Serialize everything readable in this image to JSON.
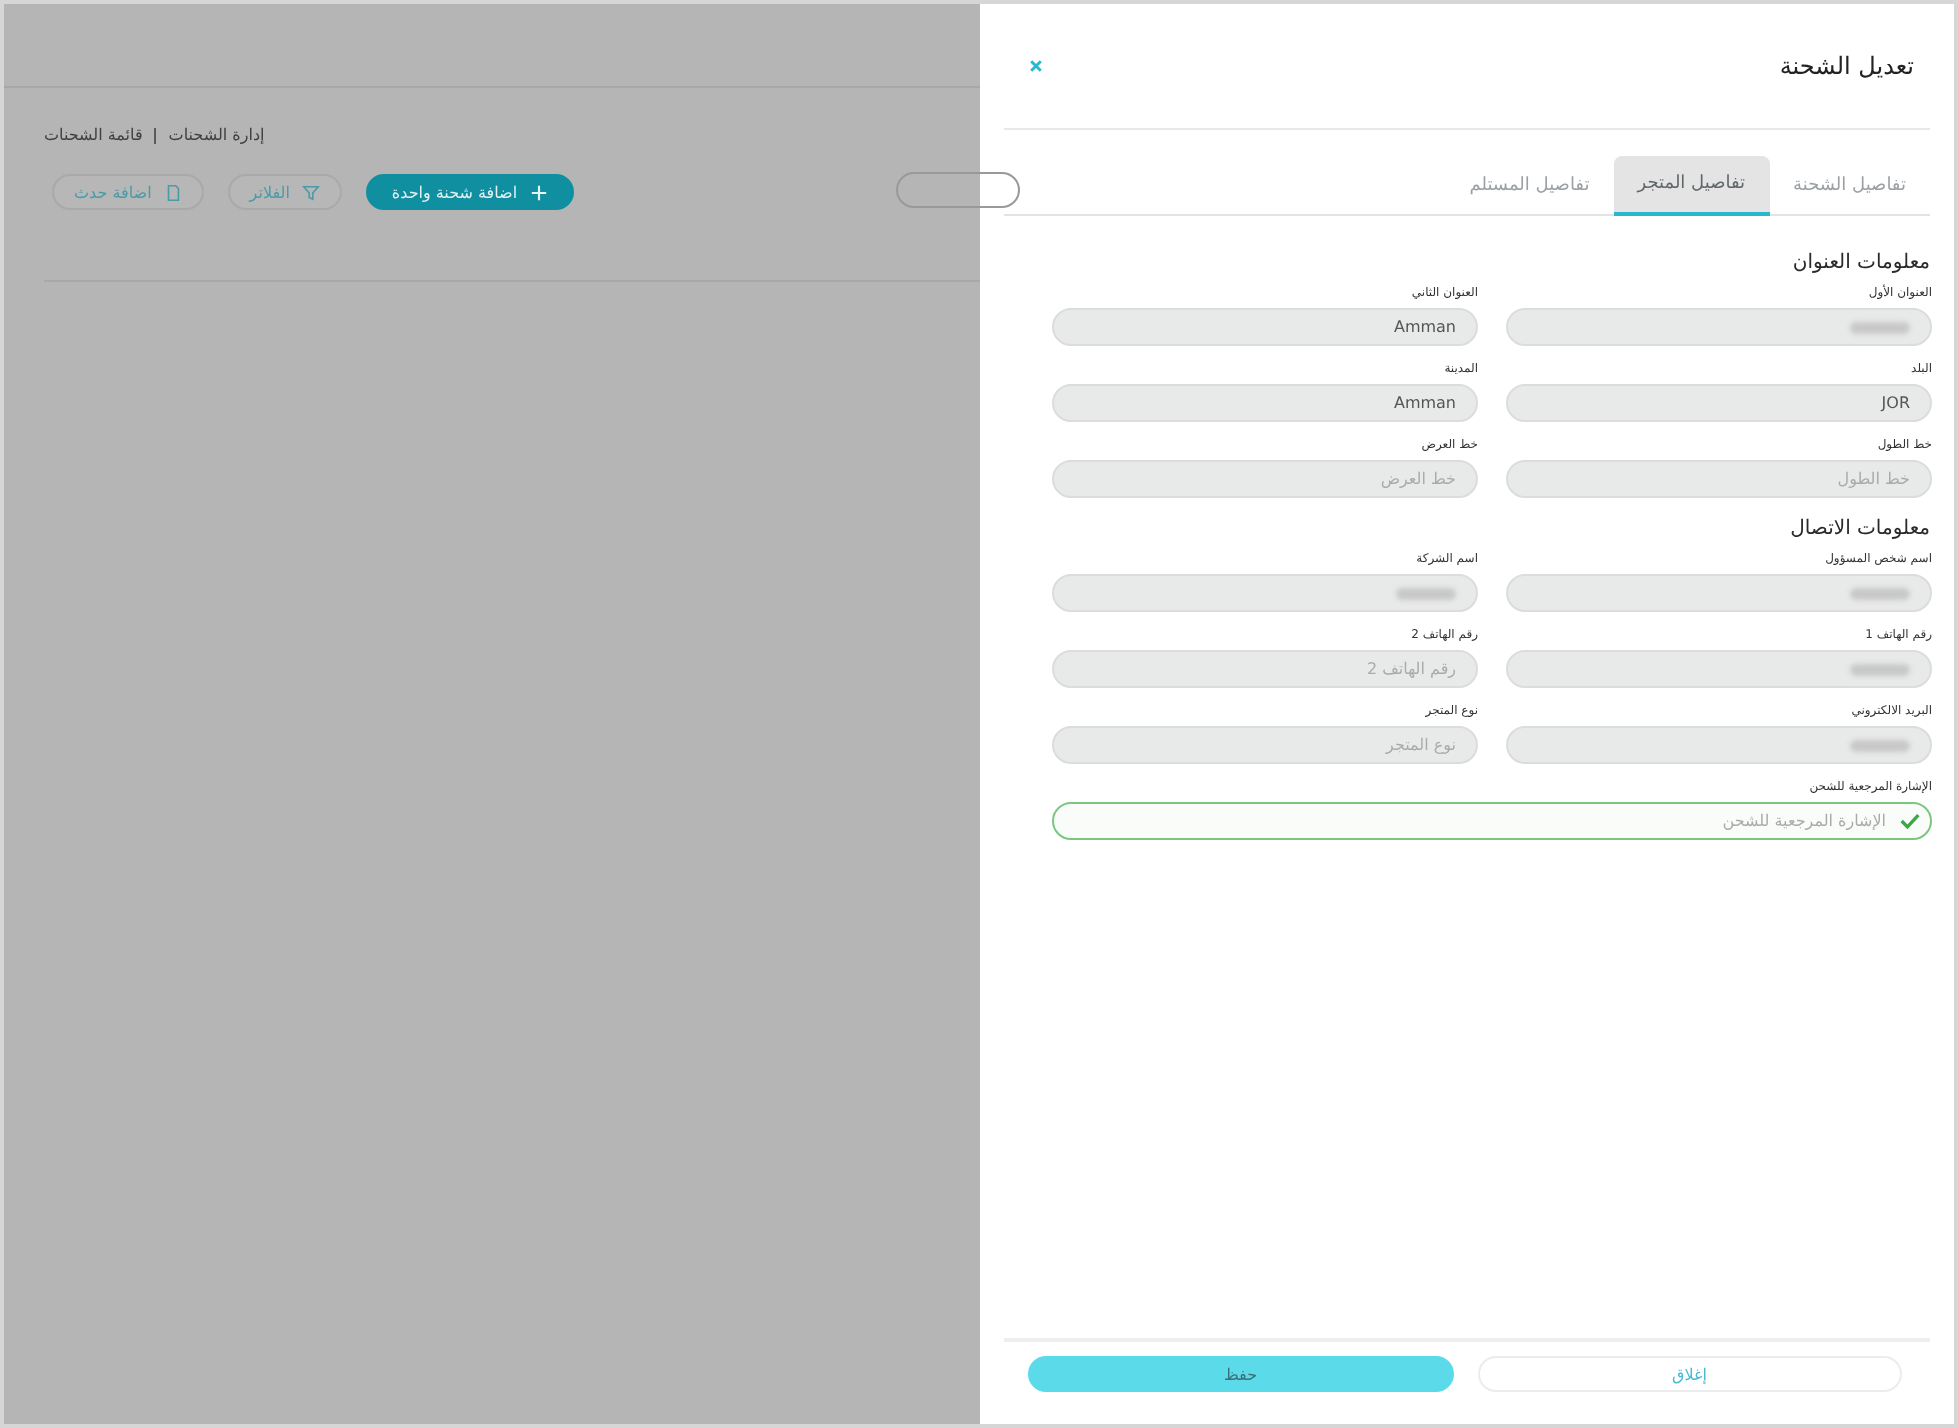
{
  "background": {
    "breadcrumb": [
      "إدارة الشحنات",
      "قائمة الشحنات"
    ],
    "buttons": [
      {
        "label": "اضافة شحنة واحدة",
        "kind": "primary"
      },
      {
        "label": "الفلاتر",
        "kind": "filter"
      },
      {
        "label": "اضافة حدث",
        "kind": "event"
      }
    ]
  },
  "drawer": {
    "title": "تعديل الشحنة",
    "tabs": [
      {
        "label": "تفاصيل الشحنة",
        "selected": false
      },
      {
        "label": "تفاصيل المتجر",
        "selected": true
      },
      {
        "label": "تفاصيل المستلم",
        "selected": false
      }
    ],
    "sections": [
      {
        "title": "معلومات العنوان",
        "fields": [
          {
            "label": "العنوان الأول",
            "kind": "redacted"
          },
          {
            "label": "العنوان الثاني",
            "value": "Amman",
            "kind": "text"
          },
          {
            "label": "البلد",
            "value": "JOR",
            "kind": "text"
          },
          {
            "label": "المدينة",
            "value": "Amman",
            "kind": "text"
          },
          {
            "label": "خط الطول",
            "placeholder": "خط الطول",
            "kind": "text"
          },
          {
            "label": "خط العرض",
            "placeholder": "خط العرض",
            "kind": "text"
          }
        ]
      },
      {
        "title": "معلومات الاتصال",
        "fields": [
          {
            "label": "اسم شخص المسؤول",
            "kind": "redacted"
          },
          {
            "label": "اسم الشركة",
            "kind": "redacted"
          },
          {
            "label": "رقم الهاتف 1",
            "kind": "redacted"
          },
          {
            "label": "رقم الهاتف 2",
            "placeholder": "رقم الهاتف 2",
            "kind": "text"
          },
          {
            "label": "البريد الالكتروني",
            "kind": "redacted"
          },
          {
            "label": "نوع المتجر",
            "placeholder": "نوع المتجر",
            "kind": "text"
          },
          {
            "label": "الإشارة المرجعية للشحن",
            "placeholder": "الإشارة المرجعية للشحن",
            "kind": "valid"
          }
        ]
      }
    ],
    "footer": [
      {
        "label": "إغلاق",
        "kind": "secondary"
      },
      {
        "label": "حفظ",
        "kind": "primary"
      }
    ]
  }
}
